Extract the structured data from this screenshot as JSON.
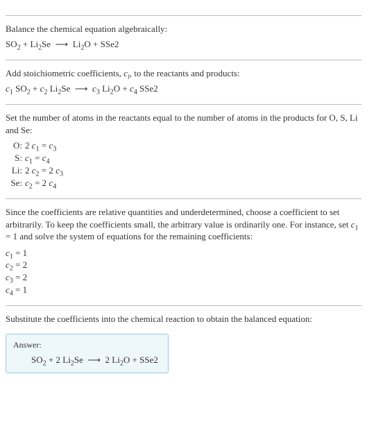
{
  "sec1": {
    "intro": "Balance the chemical equation algebraically:",
    "eq": "SO<sub>2</sub> + Li<sub>2</sub>Se &nbsp;⟶&nbsp; Li<sub>2</sub>O + SSe2"
  },
  "sec2": {
    "intro": "Add stoichiometric coefficients, <i>c<sub>i</sub></i>, to the reactants and products:",
    "eq": "<i>c</i><sub>1</sub> SO<sub>2</sub> + <i>c</i><sub>2</sub> Li<sub>2</sub>Se &nbsp;⟶&nbsp; <i>c</i><sub>3</sub> Li<sub>2</sub>O + <i>c</i><sub>4</sub> SSe2"
  },
  "sec3": {
    "intro": "Set the number of atoms in the reactants equal to the number of atoms in the products for O, S, Li and Se:",
    "rows": [
      {
        "label": "O:",
        "eq": "2 <i>c</i><sub>1</sub> = <i>c</i><sub>3</sub>"
      },
      {
        "label": "S:",
        "eq": "<i>c</i><sub>1</sub> = <i>c</i><sub>4</sub>"
      },
      {
        "label": "Li:",
        "eq": "2 <i>c</i><sub>2</sub> = 2 <i>c</i><sub>3</sub>"
      },
      {
        "label": "Se:",
        "eq": "<i>c</i><sub>2</sub> = 2 <i>c</i><sub>4</sub>"
      }
    ]
  },
  "sec4": {
    "intro": "Since the coefficients are relative quantities and underdetermined, choose a coefficient to set arbitrarily. To keep the coefficients small, the arbitrary value is ordinarily one. For instance, set <i>c</i><sub>1</sub> = 1 and solve the system of equations for the remaining coefficients:",
    "coefs": [
      "<i>c</i><sub>1</sub> = 1",
      "<i>c</i><sub>2</sub> = 2",
      "<i>c</i><sub>3</sub> = 2",
      "<i>c</i><sub>4</sub> = 1"
    ]
  },
  "sec5": {
    "intro": "Substitute the coefficients into the chemical reaction to obtain the balanced equation:"
  },
  "answer": {
    "label": "Answer:",
    "eq": "SO<sub>2</sub> + 2 Li<sub>2</sub>Se &nbsp;⟶&nbsp; 2 Li<sub>2</sub>O + SSe2"
  }
}
